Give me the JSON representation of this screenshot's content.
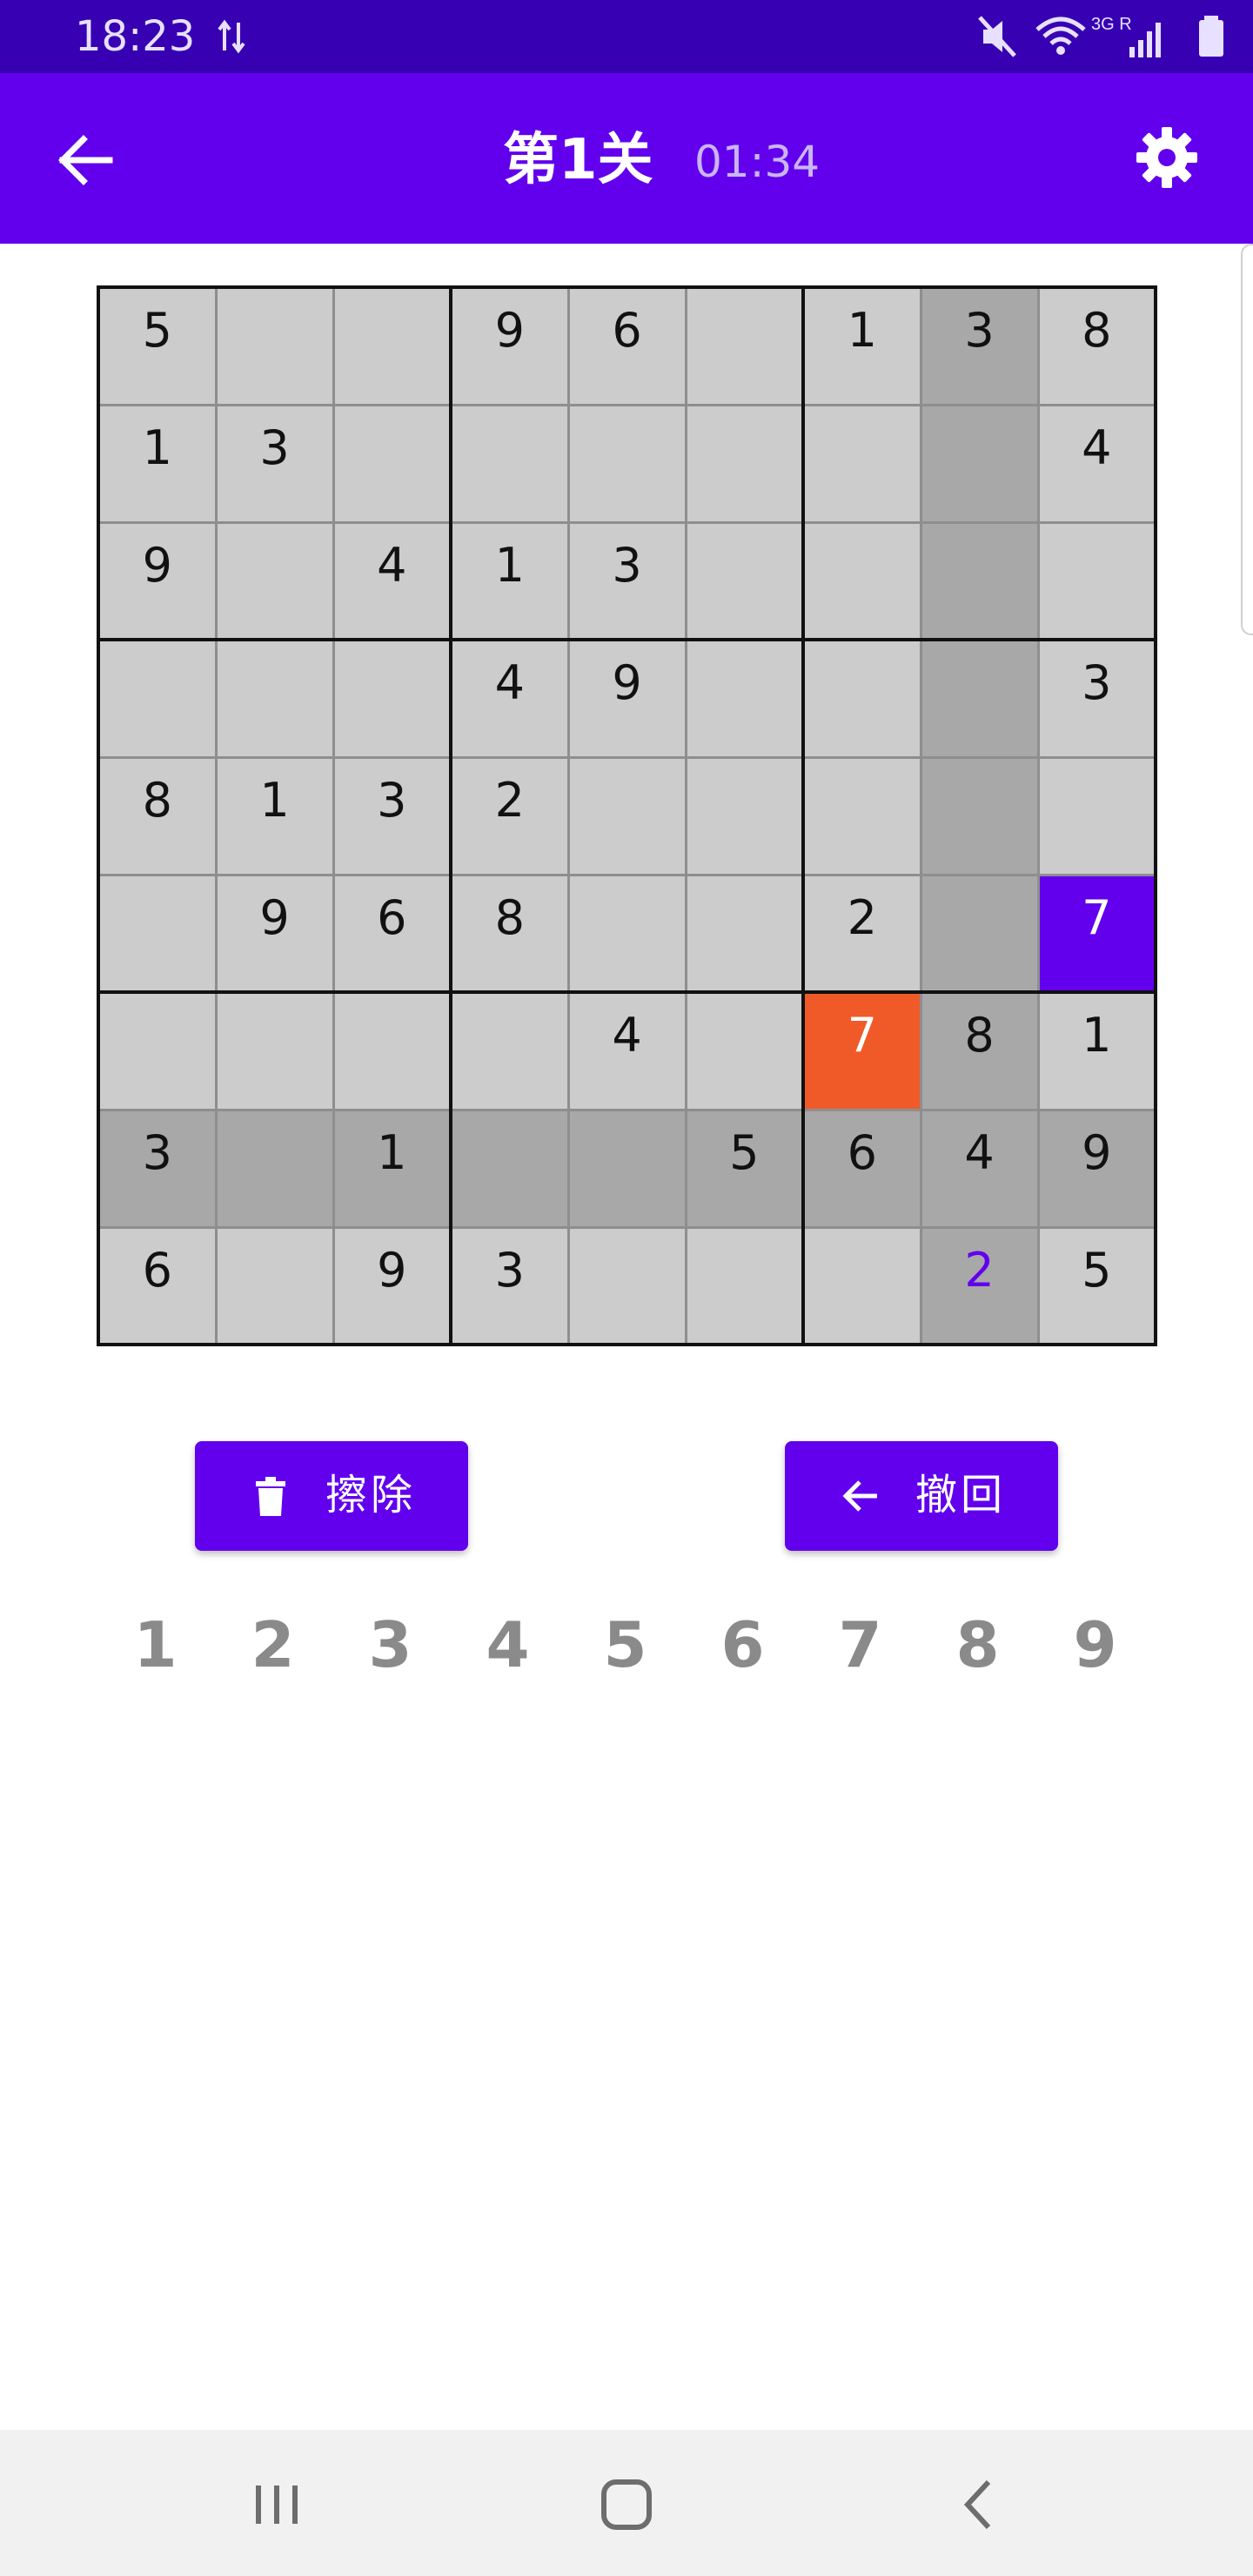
{
  "status_bar": {
    "time": "18:23",
    "network_label": "3G R",
    "icons": [
      "data-arrows-icon",
      "mute-icon",
      "wifi-icon",
      "signal-icon",
      "battery-icon"
    ]
  },
  "app_bar": {
    "title": "第1关",
    "timer": "01:34",
    "back_icon": "arrow-back-icon",
    "settings_icon": "gear-icon"
  },
  "board": {
    "selected_cell": {
      "row": 7,
      "col": 7
    },
    "highlighted_row": 7,
    "highlighted_col": 7,
    "cells": [
      [
        {
          "v": "5"
        },
        {
          "v": ""
        },
        {
          "v": ""
        },
        {
          "v": "9"
        },
        {
          "v": "6"
        },
        {
          "v": ""
        },
        {
          "v": "1"
        },
        {
          "v": "3"
        },
        {
          "v": "8"
        }
      ],
      [
        {
          "v": "1"
        },
        {
          "v": "3"
        },
        {
          "v": ""
        },
        {
          "v": ""
        },
        {
          "v": ""
        },
        {
          "v": ""
        },
        {
          "v": ""
        },
        {
          "v": ""
        },
        {
          "v": "4"
        }
      ],
      [
        {
          "v": "9"
        },
        {
          "v": ""
        },
        {
          "v": "4"
        },
        {
          "v": "1"
        },
        {
          "v": "3"
        },
        {
          "v": ""
        },
        {
          "v": ""
        },
        {
          "v": ""
        },
        {
          "v": ""
        }
      ],
      [
        {
          "v": ""
        },
        {
          "v": ""
        },
        {
          "v": ""
        },
        {
          "v": "4"
        },
        {
          "v": "9"
        },
        {
          "v": ""
        },
        {
          "v": ""
        },
        {
          "v": ""
        },
        {
          "v": "3"
        }
      ],
      [
        {
          "v": "8"
        },
        {
          "v": "1"
        },
        {
          "v": "3"
        },
        {
          "v": "2"
        },
        {
          "v": ""
        },
        {
          "v": ""
        },
        {
          "v": ""
        },
        {
          "v": ""
        },
        {
          "v": ""
        }
      ],
      [
        {
          "v": ""
        },
        {
          "v": "9"
        },
        {
          "v": "6"
        },
        {
          "v": "8"
        },
        {
          "v": ""
        },
        {
          "v": ""
        },
        {
          "v": "2"
        },
        {
          "v": ""
        },
        {
          "v": "7",
          "state": "conflict"
        }
      ],
      [
        {
          "v": ""
        },
        {
          "v": ""
        },
        {
          "v": ""
        },
        {
          "v": ""
        },
        {
          "v": "4"
        },
        {
          "v": ""
        },
        {
          "v": "7",
          "state": "selected"
        },
        {
          "v": "8"
        },
        {
          "v": "1"
        }
      ],
      [
        {
          "v": "3"
        },
        {
          "v": ""
        },
        {
          "v": "1"
        },
        {
          "v": ""
        },
        {
          "v": ""
        },
        {
          "v": "5"
        },
        {
          "v": "6"
        },
        {
          "v": "4"
        },
        {
          "v": "9"
        }
      ],
      [
        {
          "v": "6"
        },
        {
          "v": ""
        },
        {
          "v": "9"
        },
        {
          "v": "3"
        },
        {
          "v": ""
        },
        {
          "v": ""
        },
        {
          "v": ""
        },
        {
          "v": "2",
          "state": "user"
        },
        {
          "v": "5"
        }
      ]
    ]
  },
  "colors": {
    "primary": "#6200ee",
    "status_bar": "#3700b3",
    "selected_cell": "#f05a28",
    "conflict_cell": "#6200ee",
    "user_digit": "#6200ee",
    "cell_bg": "#cccccc",
    "highlight_bg": "#a8a8a8"
  },
  "actions": {
    "erase_label": "擦除",
    "erase_icon": "trash-icon",
    "undo_label": "撤回",
    "undo_icon": "arrow-back-icon"
  },
  "numpad": [
    "1",
    "2",
    "3",
    "4",
    "5",
    "6",
    "7",
    "8",
    "9"
  ],
  "nav_bar": {
    "icons": [
      "recents-icon",
      "home-icon",
      "back-chevron-icon"
    ]
  }
}
